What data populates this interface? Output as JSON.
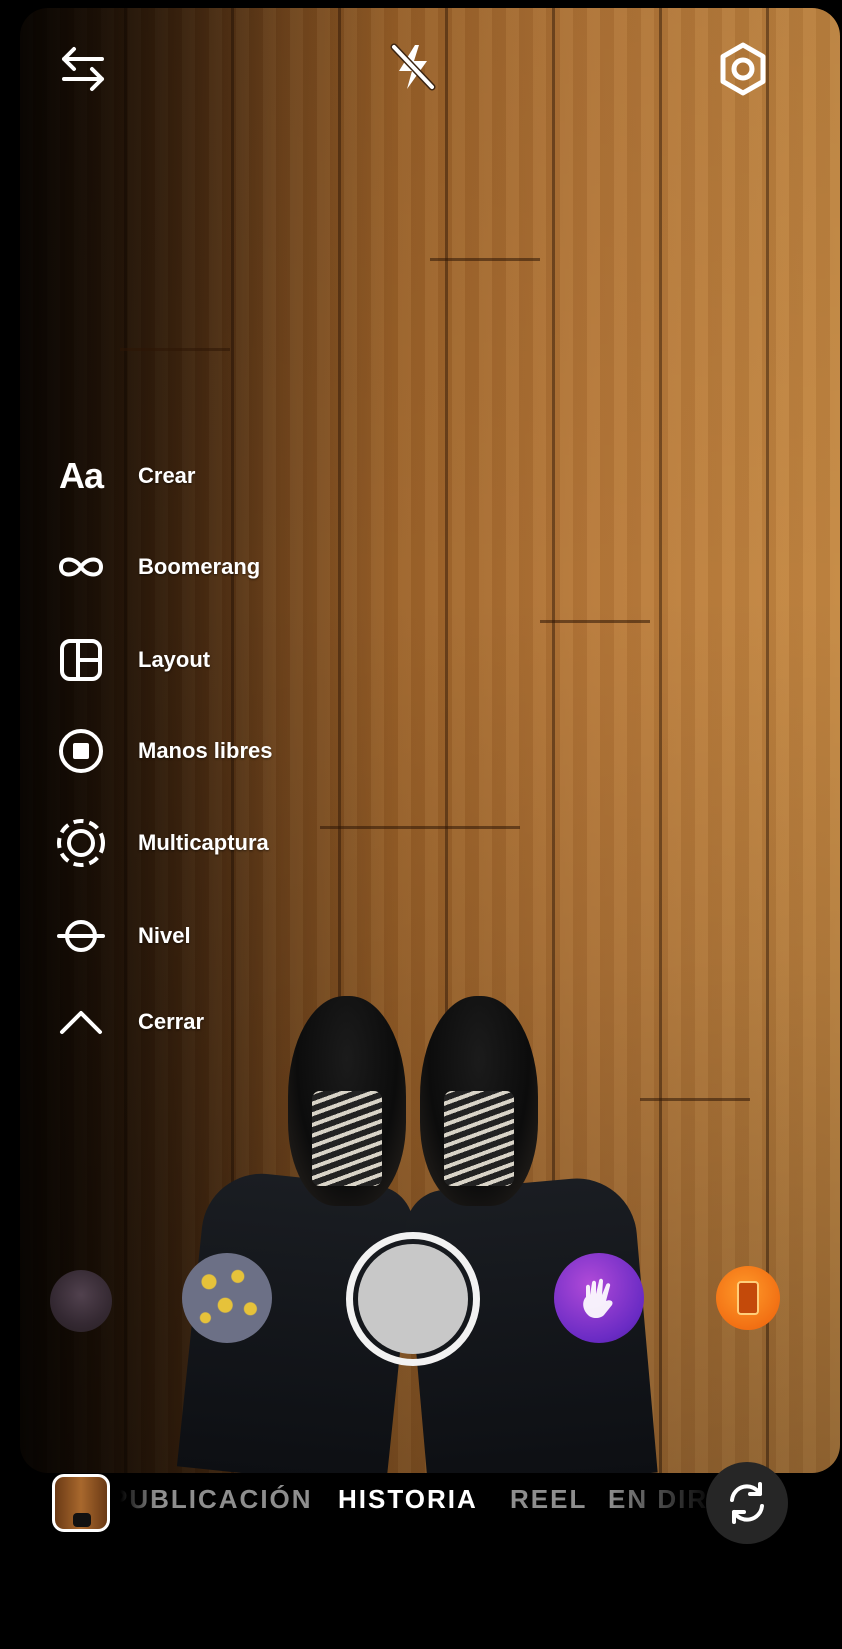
{
  "camera": {
    "top_controls": {
      "swap_icon": "arrows-swap-icon",
      "flash_icon": "flash-off-icon",
      "settings_icon": "settings-gear-icon"
    },
    "tools_menu": [
      {
        "label": "Crear",
        "icon": "aa-text-icon",
        "glyph": "Aa"
      },
      {
        "label": "Boomerang",
        "icon": "infinity-icon"
      },
      {
        "label": "Layout",
        "icon": "layout-grid-icon"
      },
      {
        "label": "Manos libres",
        "icon": "hands-free-record-icon"
      },
      {
        "label": "Multicaptura",
        "icon": "multi-capture-icon"
      },
      {
        "label": "Nivel",
        "icon": "level-icon"
      },
      {
        "label": "Cerrar",
        "icon": "chevron-up-icon"
      }
    ],
    "effects": [
      "effect-face-filter",
      "effect-dots-filter",
      "effect-wave-hand-filter",
      "effect-orange-filter"
    ]
  },
  "bottom_bar": {
    "modes": [
      {
        "label": "PUBLICACIÓN",
        "active": false
      },
      {
        "label": "HISTORIA",
        "active": true
      },
      {
        "label": "REEL",
        "active": false
      },
      {
        "label": "EN DIRECTO",
        "active": false
      }
    ],
    "gallery_icon": "gallery-thumbnail",
    "flip_icon": "flip-camera-icon"
  },
  "colors": {
    "active_mode": "#ffffff",
    "inactive_mode": "#8e8e8e",
    "shutter_ring": "#f2f2f2"
  }
}
